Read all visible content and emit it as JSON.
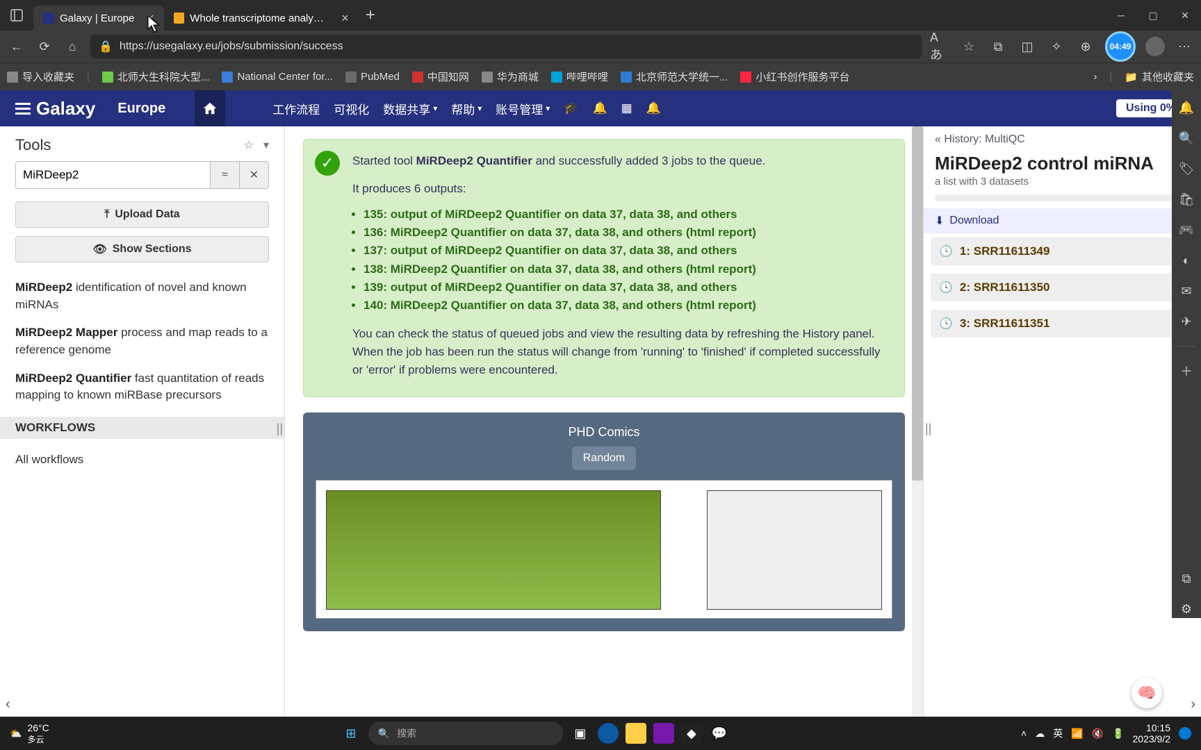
{
  "browser": {
    "tabs": [
      {
        "title": "Galaxy | Europe",
        "active": true,
        "favicon_color": "#25317e"
      },
      {
        "title": "Whole transcriptome analysis of",
        "active": false,
        "favicon_color": "#f5a623"
      }
    ],
    "url": "https://usegalaxy.eu/jobs/submission/success",
    "time_badge": "04:49",
    "bookmarks": [
      {
        "label": "导入收藏夹",
        "color": "#888"
      },
      {
        "label": "北师大生科院大型...",
        "color": "#6ecb4b"
      },
      {
        "label": "National Center for...",
        "color": "#3b7dd8"
      },
      {
        "label": "PubMed",
        "color": "#6b6b6b"
      },
      {
        "label": "中国知网",
        "color": "#d0332e"
      },
      {
        "label": "华为商城",
        "color": "#888"
      },
      {
        "label": "哔哩哔哩",
        "color": "#00a1d6"
      },
      {
        "label": "北京师范大学统一...",
        "color": "#2e7bd6"
      },
      {
        "label": "小红书创作服务平台",
        "color": "#ff2442"
      }
    ],
    "other_bookmarks": "其他收藏夹"
  },
  "galaxy": {
    "brand": "Galaxy",
    "brand_sub": "Europe",
    "nav": {
      "workflow": "工作流程",
      "visualize": "可视化",
      "data_share": "数据共享",
      "help": "帮助",
      "account": "账号管理"
    },
    "using": "Using 0%"
  },
  "tools": {
    "header": "Tools",
    "search_value": "MiRDeep2",
    "upload": "Upload Data",
    "show_sections": "Show Sections",
    "items": [
      {
        "name": "MiRDeep2",
        "desc": " identification of novel and known miRNAs"
      },
      {
        "name": "MiRDeep2 Mapper",
        "desc": " process and map reads to a reference genome"
      },
      {
        "name": "MiRDeep2 Quantifier",
        "desc": " fast quantitation of reads mapping to known miRBase precursors"
      }
    ],
    "workflows_header": "WORKFLOWS",
    "all_workflows": "All workflows"
  },
  "submission": {
    "started_prefix": "Started tool ",
    "tool_name": "MiRDeep2 Quantifier",
    "started_suffix": " and successfully added 3 jobs to the queue.",
    "produces": "It produces 6 outputs:",
    "outputs": [
      "135: output of MiRDeep2 Quantifier on data 37, data 38, and others",
      "136: MiRDeep2 Quantifier on data 37, data 38, and others (html report)",
      "137: output of MiRDeep2 Quantifier on data 37, data 38, and others",
      "138: MiRDeep2 Quantifier on data 37, data 38, and others (html report)",
      "139: output of MiRDeep2 Quantifier on data 37, data 38, and others",
      "140: MiRDeep2 Quantifier on data 37, data 38, and others (html report)"
    ],
    "footer": "You can check the status of queued jobs and view the resulting data by refreshing the History panel. When the job has been run the status will change from 'running' to 'finished' if completed successfully or 'error' if problems were encountered."
  },
  "comic": {
    "title": "PHD Comics",
    "random": "Random"
  },
  "history": {
    "back": "History: MultiQC",
    "title": "MiRDeep2 control miRNA",
    "subtitle": "a list with 3 datasets",
    "download": "Download",
    "datasets": [
      {
        "label": "1: SRR11611349"
      },
      {
        "label": "2: SRR11611350"
      },
      {
        "label": "3: SRR11611351"
      }
    ]
  },
  "taskbar": {
    "temp": "26°C",
    "weather": "多云",
    "search_placeholder": "搜索",
    "ime": "英",
    "time": "10:15",
    "date": "2023/9/2"
  }
}
